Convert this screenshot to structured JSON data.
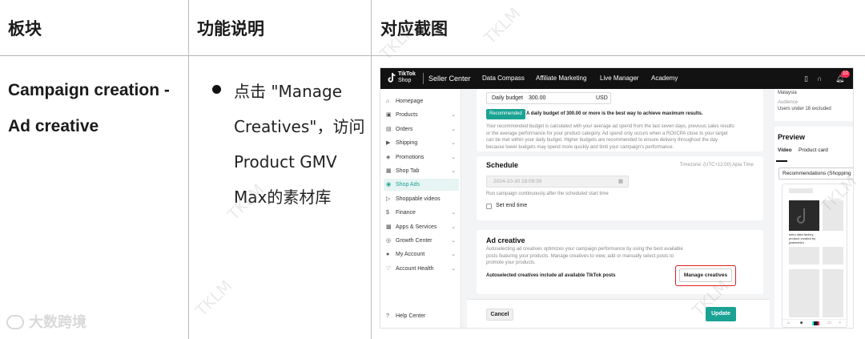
{
  "table": {
    "headers": [
      "板块",
      "功能说明",
      "对应截图"
    ],
    "row": {
      "module": "Campaign creation - Ad creative",
      "bullet": "点击 \"Manage Creatives\"，访问Product GMV Max的素材库"
    }
  },
  "screenshot": {
    "logo": {
      "line1": "TikTok",
      "line2": "Shop"
    },
    "brand": "Seller Center",
    "nav": [
      "Data Compass",
      "Affiliate Marketing",
      "Live Manager",
      "Academy"
    ],
    "badge_count": "10",
    "sidebar": [
      {
        "label": "Homepage",
        "icon": "home-icon",
        "chevron": false,
        "active": false
      },
      {
        "label": "Products",
        "icon": "box-icon",
        "chevron": true,
        "active": false
      },
      {
        "label": "Orders",
        "icon": "orders-icon",
        "chevron": true,
        "active": false
      },
      {
        "label": "Shipping",
        "icon": "truck-icon",
        "chevron": true,
        "active": false
      },
      {
        "label": "Promotions",
        "icon": "tag-icon",
        "chevron": true,
        "active": false
      },
      {
        "label": "Shop Tab",
        "icon": "shop-icon",
        "chevron": true,
        "active": false
      },
      {
        "label": "Shop Ads",
        "icon": "ads-icon",
        "chevron": false,
        "active": true
      },
      {
        "label": "Shoppable videos",
        "icon": "video-icon",
        "chevron": false,
        "active": false
      },
      {
        "label": "Finance",
        "icon": "finance-icon",
        "chevron": true,
        "active": false
      },
      {
        "label": "Apps & Services",
        "icon": "apps-icon",
        "chevron": true,
        "active": false
      },
      {
        "label": "Growth Center",
        "icon": "growth-icon",
        "chevron": true,
        "active": false
      },
      {
        "label": "My Account",
        "icon": "account-icon",
        "chevron": true,
        "active": false
      },
      {
        "label": "Account Health",
        "icon": "health-icon",
        "chevron": true,
        "active": false
      }
    ],
    "help_center": "Help Center",
    "budget": {
      "label": "Daily budget",
      "value": "300.00",
      "currency": "USD",
      "recommended": "Recommended",
      "recommended_note": "A daily budget of 300.00 or more is the best way to achieve maximum results.",
      "paragraph": "Your recommended budget is calculated with your average ad spend from the last seven days, previous sales results or the average performance for your product category. Ad spend only occurs when a ROI/CPA close to your target can be met within your daily budget. Higher budgets are recommended to ensure delivery throughout the day because lower budgets may spend more quickly and limit your campaign's performance."
    },
    "schedule": {
      "title": "Schedule",
      "timezone": "Timezone: (UTC+12:00) Apia Time",
      "start_date": "2024-10-30 18:09:39",
      "hint": "Run campaign continuously after the scheduled start time",
      "set_end_time": "Set end time"
    },
    "ad_creative": {
      "title": "Ad creative",
      "description": "Autoselecting ad creatives optimizes your campaign performance by using the best available posts featuring your products. Manage creatives to view, add or manually select posts to promote your products.",
      "autoselected_note": "Autoselected creatives include all available TikTok posts",
      "manage_button": "Manage creatives"
    },
    "footer": {
      "cancel": "Cancel",
      "update": "Update"
    },
    "right_panel": {
      "region": "Malaysia",
      "audience_label": "Audience",
      "audience_value": "Users under 18 excluded",
      "preview_title": "Preview",
      "tabs": [
        "Video",
        "Product card"
      ],
      "placement": "Recommendations (Shopping",
      "post_caption": "shiro data factory product created by jwaimshiro"
    }
  },
  "watermark": "TKLM",
  "corner_logo": "大数跨境"
}
